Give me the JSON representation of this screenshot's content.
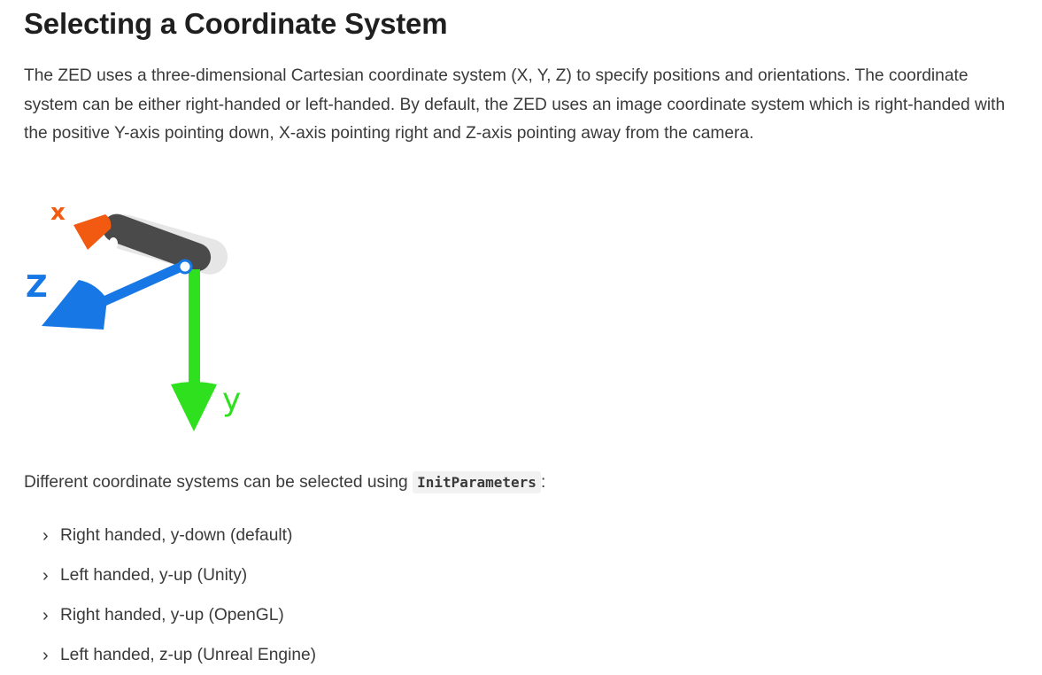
{
  "heading": "Selecting a Coordinate System",
  "intro": "The ZED uses a three-dimensional Cartesian coordinate system (X, Y, Z) to specify positions and orientations. The coordinate system can be either right-handed or left-handed. By default, the ZED uses an image coordinate system which is right-handed with the positive Y-axis pointing down, X-axis pointing right and Z-axis pointing away from the camera.",
  "diagram": {
    "x_label": "x",
    "y_label": "y",
    "z_label": "Z",
    "colors": {
      "x_axis": "#f25a12",
      "y_axis": "#2ee01e",
      "z_axis": "#1677e5",
      "camera_body": "#4a4a4a",
      "camera_shadow": "#e6e6e6"
    }
  },
  "selection": {
    "prefix": "Different coordinate systems can be selected using ",
    "code": "InitParameters",
    "suffix": ":"
  },
  "options": [
    {
      "label": "Right handed, y-down (default)",
      "icon": "chevron-right-icon"
    },
    {
      "label": "Left handed, y-up (Unity)",
      "icon": "chevron-right-icon"
    },
    {
      "label": "Right handed, y-up (OpenGL)",
      "icon": "chevron-right-icon"
    },
    {
      "label": "Left handed, z-up (Unreal Engine)",
      "icon": "chevron-right-icon"
    }
  ]
}
